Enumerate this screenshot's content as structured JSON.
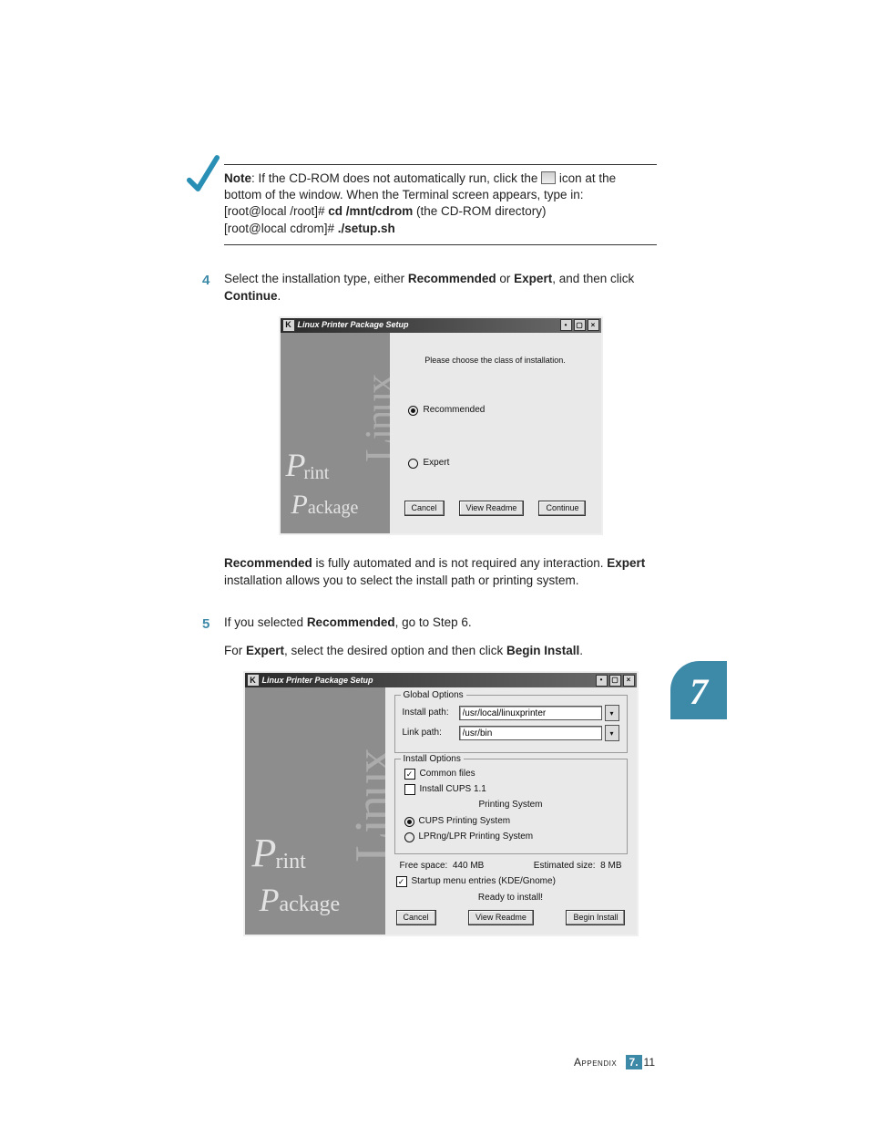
{
  "note": {
    "label": "Note",
    "line1_a": ": If the CD-ROM does not automatically run, click the ",
    "line1_b": " icon at the bottom of the window. When the Terminal screen appears, type in:",
    "line2_a": "[root@local /root]# ",
    "cmd1": "cd /mnt/cdrom",
    "line2_b": " (the CD-ROM directory)",
    "line3_a": "[root@local cdrom]# ",
    "cmd2": "./setup.sh"
  },
  "step4": {
    "num": "4",
    "a": "Select the installation type, either ",
    "b": "Recommended",
    "c": " or ",
    "d": "Expert",
    "e": ", and then click ",
    "f": "Continue",
    "g": "."
  },
  "shot1": {
    "k": "K",
    "title": "Linux Printer Package Setup",
    "hint": "Please choose the class of installation.",
    "optRec": "Recommended",
    "optExp": "Expert",
    "btnCancel": "Cancel",
    "btnReadme": "View Readme",
    "btnContinue": "Continue",
    "side_linux": "Linux",
    "side_print": "rint",
    "side_package": "ackage"
  },
  "para_rec": {
    "a": "Recommended",
    "b": " is fully automated and is not required any interaction. ",
    "c": "Expert",
    "d": " installation allows you to select the install path or printing system."
  },
  "step5": {
    "num": "5",
    "a": "If you selected ",
    "b": "Recommended",
    "c": ", go to Step 6.",
    "d": "For ",
    "e": "Expert",
    "f": ", select the desired option and then click ",
    "g": "Begin Install",
    "h": "."
  },
  "shot2": {
    "k": "K",
    "title": "Linux Printer Package Setup",
    "grpGlobal": "Global Options",
    "lblInstall": "Install path:",
    "valInstall": "/usr/local/linuxprinter",
    "lblLink": "Link path:",
    "valLink": "/usr/bin",
    "grpInstall": "Install Options",
    "chkCommon": "Common files",
    "chkCups": "Install CUPS 1.1",
    "subheadPS": "Printing System",
    "radCups": "CUPS Printing System",
    "radLpr": "LPRng/LPR Printing System",
    "freeLabel": "Free space:",
    "freeVal": "440 MB",
    "estLabel": "Estimated size:",
    "estVal": "8 MB",
    "chkMenu": "Startup menu entries (KDE/Gnome)",
    "ready": "Ready to install!",
    "btnCancel": "Cancel",
    "btnReadme": "View Readme",
    "btnBegin": "Begin Install",
    "side_linux": "Linux",
    "side_print": "rint",
    "side_package": "ackage"
  },
  "chapter": "7",
  "footer": {
    "appendix": "Appendix",
    "major": "7.",
    "minor": "11"
  }
}
